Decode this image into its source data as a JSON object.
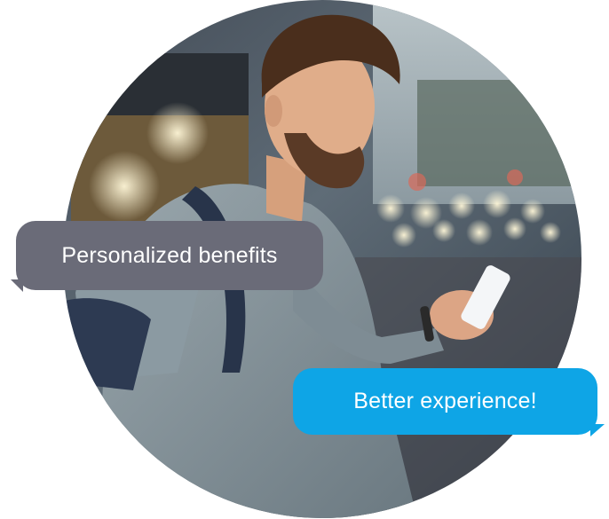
{
  "bubbles": {
    "primary": "Personalized benefits",
    "secondary": "Better experience!"
  },
  "colors": {
    "grey_bubble": "#6a6b78",
    "blue_bubble": "#0ea5e6",
    "coat": "#7f8f99",
    "beard": "#5a3a26"
  }
}
